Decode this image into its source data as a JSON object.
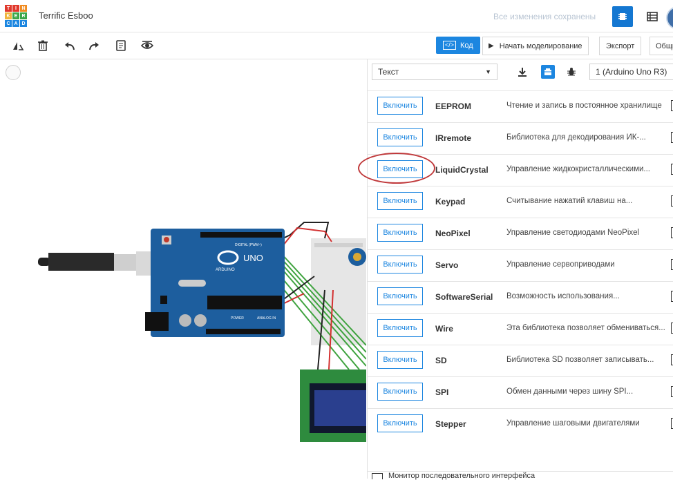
{
  "header": {
    "logo_letters": [
      "T",
      "I",
      "N",
      "K",
      "E",
      "R",
      "C",
      "A",
      "D"
    ],
    "title": "Terrific Esboo",
    "save_status": "Все изменения сохранены"
  },
  "toolbar": {
    "code_label": "Код",
    "simulate_label": "Начать моделирование",
    "export_label": "Экспорт",
    "share_label": "Общи"
  },
  "code_panel": {
    "mode": "Текст",
    "device": "1 (Arduino Uno R3)",
    "libraries": [
      {
        "button": "Включить",
        "name": "EEPROM",
        "description": "Чтение и запись в постоянное хранилище"
      },
      {
        "button": "Включить",
        "name": "IRremote",
        "description": "Библиотека для декодирования ИК-..."
      },
      {
        "button": "Включить",
        "name": "LiquidCrystal",
        "description": "Управление жидкокристаллическими..."
      },
      {
        "button": "Включить",
        "name": "Keypad",
        "description": "Считывание нажатий клавиш на..."
      },
      {
        "button": "Включить",
        "name": "NeoPixel",
        "description": "Управление светодиодами NeoPixel"
      },
      {
        "button": "Включить",
        "name": "Servo",
        "description": "Управление сервоприводами"
      },
      {
        "button": "Включить",
        "name": "SoftwareSerial",
        "description": "Возможность использования..."
      },
      {
        "button": "Включить",
        "name": "Wire",
        "description": "Эта библиотека позволяет обмениваться..."
      },
      {
        "button": "Включить",
        "name": "SD",
        "description": "Библиотека SD позволяет записывать..."
      },
      {
        "button": "Включить",
        "name": "SPI",
        "description": "Обмен данными через шину SPI..."
      },
      {
        "button": "Включить",
        "name": "Stepper",
        "description": "Управление шаговыми двигателями"
      }
    ],
    "serial_monitor_label": "Монитор последовательного интерфейса"
  },
  "circuit": {
    "board_brand": "ARDUINO",
    "board_model": "UNO",
    "digital_label": "DIGITAL (PWM~)",
    "power_label": "POWER",
    "analog_label": "ANALOG IN"
  },
  "colors": {
    "accent": "#1c86e0",
    "highlight": "#c0393b",
    "board": "#1d5e9e",
    "lcd": "#2e8b3e"
  }
}
